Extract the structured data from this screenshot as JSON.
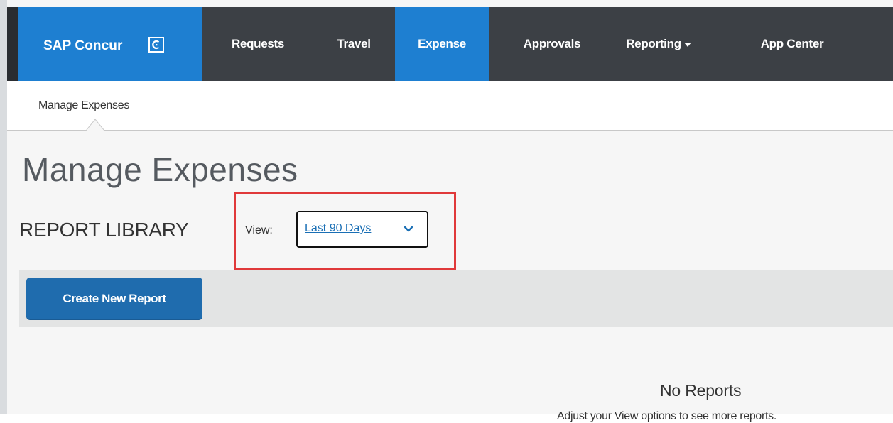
{
  "brand": {
    "name": "SAP Concur",
    "logo_icon": "concur-c-logo-icon"
  },
  "nav": {
    "items": [
      {
        "label": "Requests"
      },
      {
        "label": "Travel"
      },
      {
        "label": "Expense",
        "active": true
      },
      {
        "label": "Approvals"
      },
      {
        "label": "Reporting",
        "has_dropdown": true
      },
      {
        "label": "App Center"
      }
    ]
  },
  "subnav": {
    "items": [
      {
        "label": "Manage Expenses",
        "active": true
      }
    ]
  },
  "page": {
    "title": "Manage Expenses",
    "section_title": "REPORT LIBRARY",
    "view": {
      "label": "View:",
      "value": "Last 90 Days"
    },
    "toolbar": {
      "create_label": "Create New Report"
    },
    "empty": {
      "title": "No Reports",
      "message": "Adjust your View options to see more reports."
    }
  },
  "colors": {
    "nav_bg": "#3c4045",
    "brand_blue": "#1e7fd1",
    "button_blue": "#1f6cae",
    "highlight_red": "#e0393a",
    "link_blue": "#1a6fb5"
  }
}
